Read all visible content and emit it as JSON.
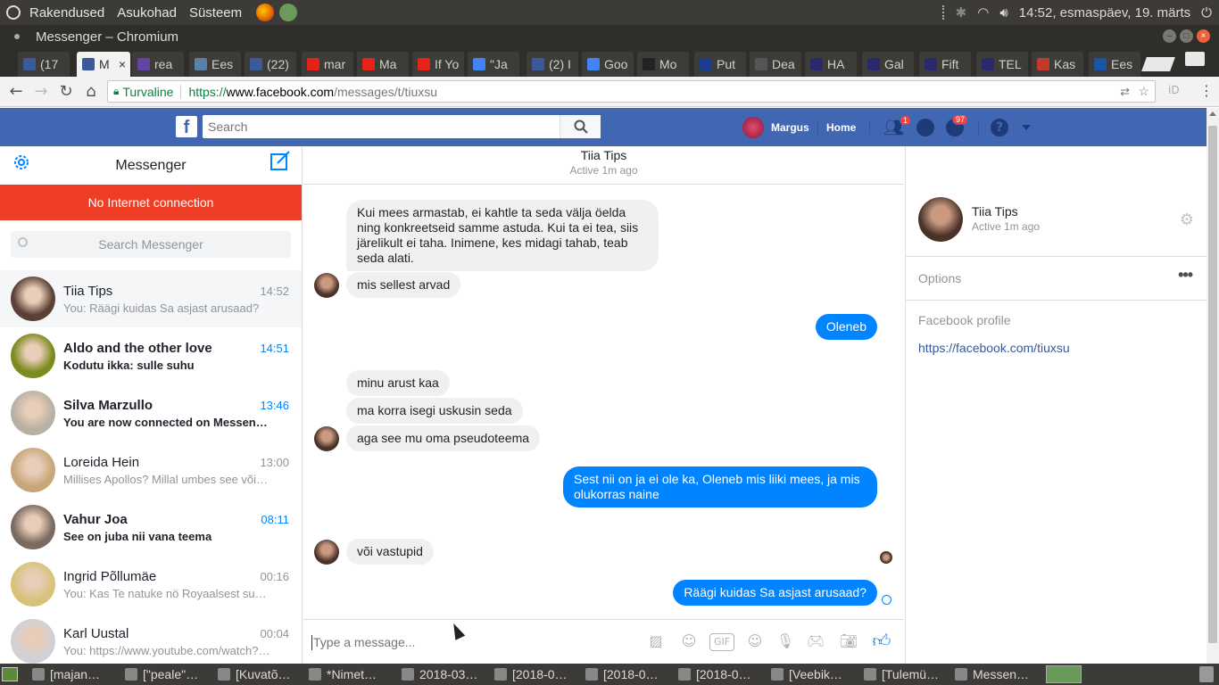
{
  "os": {
    "menus": [
      "Rakendused",
      "Asukohad",
      "Süsteem"
    ],
    "clock": "14:52, esmaspäev, 19. märts"
  },
  "window": {
    "title": "Messenger – Chromium"
  },
  "browser": {
    "tabs": [
      {
        "label": "(17",
        "color": "#3b5998"
      },
      {
        "label": "M",
        "color": "#3b5998"
      },
      {
        "label": "rea",
        "color": "#6441a4"
      },
      {
        "label": "Ees",
        "color": "#5b7fa6"
      },
      {
        "label": "(22)",
        "color": "#3b5998"
      },
      {
        "label": "mar",
        "color": "#e62117"
      },
      {
        "label": "Ma",
        "color": "#e62117"
      },
      {
        "label": "If Yo",
        "color": "#e62117"
      },
      {
        "label": "\"Ja",
        "color": "#4285f4"
      },
      {
        "label": "(2) I",
        "color": "#3b5998"
      },
      {
        "label": "Goo",
        "color": "#4285f4"
      },
      {
        "label": "Mo",
        "color": "#222222"
      },
      {
        "label": "Put",
        "color": "#1a3c8f"
      },
      {
        "label": "Dea",
        "color": "#555555"
      },
      {
        "label": "HA",
        "color": "#2a2a6a"
      },
      {
        "label": "Gal",
        "color": "#2a2a6a"
      },
      {
        "label": "Fift",
        "color": "#2a2a6a"
      },
      {
        "label": "TEL",
        "color": "#2a2a6a"
      },
      {
        "label": "Kas",
        "color": "#c0392b"
      },
      {
        "label": "Ees",
        "color": "#1a56a8"
      }
    ],
    "secure_label": "Turvaline",
    "url_scheme": "https://",
    "url_host": "www.facebook.com",
    "url_path": "/messages/t/tiuxsu"
  },
  "facebook": {
    "search_placeholder": "Search",
    "user_name": "Margus",
    "home_label": "Home",
    "friends_badge": "1",
    "notif_badge": "97"
  },
  "messenger": {
    "title": "Messenger",
    "no_internet": "No Internet connection",
    "search_placeholder": "Search Messenger",
    "conversations": [
      {
        "name": "Tiia Tips",
        "snippet": "You: Räägi kuidas Sa asjast arusaad?",
        "time": "14:52",
        "unread": false,
        "active": true,
        "color": "#5a4036"
      },
      {
        "name": "Aldo and the other love",
        "snippet": "Kodutu ikka: sulle suhu",
        "time": "14:51",
        "unread": true,
        "active": false,
        "color": "#7d8b1e"
      },
      {
        "name": "Silva Marzullo",
        "snippet": "You are now connected on Messen…",
        "time": "13:46",
        "unread": true,
        "active": false,
        "color": "#b9b0a4"
      },
      {
        "name": "Loreida Hein",
        "snippet": "Millises Apollos? Millal umbes see või…",
        "time": "13:00",
        "unread": false,
        "active": false,
        "color": "#c7a77a"
      },
      {
        "name": "Vahur Joa",
        "snippet": "See on juba nii vana teema",
        "time": "08:11",
        "unread": true,
        "active": false,
        "color": "#7a6a60"
      },
      {
        "name": "Ingrid Põllumäe",
        "snippet": "You: Kas Te natuke nö Royaalsest su…",
        "time": "00:16",
        "unread": false,
        "active": false,
        "color": "#d8c27a"
      },
      {
        "name": "Karl Uustal",
        "snippet": "You: https://www.youtube.com/watch?…",
        "time": "00:04",
        "unread": false,
        "active": false,
        "color": "#d0d1d5"
      }
    ]
  },
  "chat": {
    "name": "Tiia Tips",
    "status": "Active 1m ago",
    "composer_placeholder": "Type a message...",
    "messages": [
      {
        "dir": "in",
        "text": "Kui mees armastab, ei kahtle ta seda välja öelda ning konkreetseid samme astuda. Kui ta ei tea, siis järelikult ei taha. Inimene, kes midagi tahab, teab seda alati."
      },
      {
        "dir": "in",
        "text": "mis sellest arvad"
      },
      {
        "dir": "out",
        "text": "Oleneb"
      },
      {
        "dir": "in",
        "text": "minu arust kaa"
      },
      {
        "dir": "in",
        "text": "ma korra isegi uskusin seda"
      },
      {
        "dir": "in",
        "text": "aga see mu oma pseudoteema"
      },
      {
        "dir": "out",
        "text": "Sest nii on ja ei ole ka, Oleneb mis liiki mees, ja mis olukorras naine"
      },
      {
        "dir": "in",
        "text": "või vastupid"
      },
      {
        "dir": "out",
        "text": "Räägi kuidas Sa asjast arusaad?"
      }
    ]
  },
  "details": {
    "name": "Tiia Tips",
    "status": "Active 1m ago",
    "options_label": "Options",
    "profile_heading": "Facebook profile",
    "profile_url": "https://facebook.com/tiuxsu"
  },
  "taskbar": {
    "items": [
      "[majan…",
      "[\"peale\"…",
      "[Kuvatõ…",
      "*Nimet…",
      "2018-03…",
      "[2018-0…",
      "[2018-0…",
      "[2018-0…",
      "[Veebik…",
      "[Tulemü…",
      "Messen…"
    ]
  }
}
